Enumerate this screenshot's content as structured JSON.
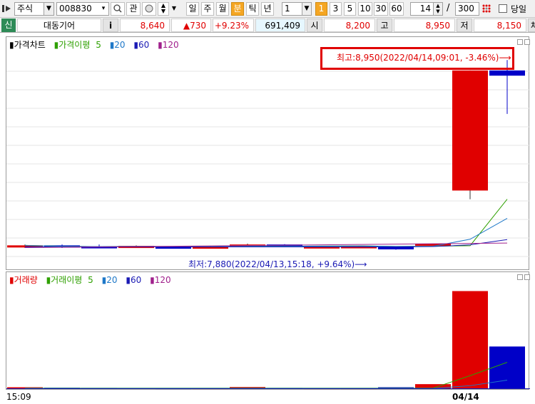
{
  "toolbar": {
    "market": "주식",
    "code": "008830",
    "btn_gwan": "관",
    "periods": [
      "일",
      "주",
      "월",
      "분",
      "틱",
      "년"
    ],
    "active_period": "분",
    "interval_value": "1",
    "interval_presets": [
      "1",
      "3",
      "5",
      "10",
      "30",
      "60"
    ],
    "active_preset": "1",
    "count_value": "14",
    "count_sep": "/",
    "count_total": "300",
    "today_label": "당일"
  },
  "info": {
    "badge": "신",
    "name": "대동기어",
    "info_btn": "i",
    "price": "8,640",
    "change": "▲730",
    "change_pct": "+9.23%",
    "volume": "691,409",
    "open_label": "시",
    "open": "8,200",
    "high_label": "고",
    "high": "8,950",
    "low_label": "저",
    "low": "8,150",
    "trade_label": "체결강"
  },
  "price_panel": {
    "legend_main": "가격차트",
    "legend_ma_label": "가격이평",
    "legend_ma": [
      "5",
      "20",
      "60",
      "120"
    ],
    "high_annotation": "최고:8,950(2022/04/14,09:01, -3.46%)⟶",
    "low_annotation": "최저:7,880(2022/04/13,15:18, +9.64%)⟶"
  },
  "volume_panel": {
    "legend_main": "거래량",
    "legend_ma_label": "거래이평",
    "legend_ma": [
      "5",
      "20",
      "60",
      "120"
    ]
  },
  "x_axis": {
    "left_label": "15:09",
    "date_label": "04/14"
  },
  "colors": {
    "up": "#e00000",
    "down": "#0000c8",
    "ma5": "#2ea000",
    "ma20": "#1e78c8",
    "ma60": "#1a1ab4",
    "ma120": "#a0208c",
    "annotation_box": "#e00000"
  },
  "chart_data": {
    "type": "candlestick",
    "ohlc": [
      {
        "open": 7880,
        "high": 7890,
        "low": 7870,
        "close": 7885
      },
      {
        "open": 7885,
        "high": 7890,
        "low": 7870,
        "close": 7875
      },
      {
        "open": 7880,
        "high": 7890,
        "low": 7870,
        "close": 7875
      },
      {
        "open": 7875,
        "high": 7885,
        "low": 7870,
        "close": 7882
      },
      {
        "open": 7878,
        "high": 7880,
        "low": 7870,
        "close": 7875
      },
      {
        "open": 7875,
        "high": 7880,
        "low": 7870,
        "close": 7878
      },
      {
        "open": 7878,
        "high": 7895,
        "low": 7875,
        "close": 7890
      },
      {
        "open": 7890,
        "high": 7892,
        "low": 7876,
        "close": 7880
      },
      {
        "open": 7878,
        "high": 7882,
        "low": 7874,
        "close": 7879
      },
      {
        "open": 7879,
        "high": 7880,
        "low": 7874,
        "close": 7880
      },
      {
        "open": 7880,
        "high": 7880,
        "low": 7860,
        "close": 7862
      },
      {
        "open": 7890,
        "high": 7895,
        "low": 7890,
        "close": 7895
      },
      {
        "open": 8200,
        "high": 8890,
        "low": 8150,
        "close": 8890
      },
      {
        "open": 8890,
        "high": 8950,
        "low": 8640,
        "close": 8860
      }
    ],
    "volume": [
      8000,
      6000,
      5000,
      4000,
      3000,
      3000,
      9000,
      5000,
      3000,
      3000,
      8000,
      22000,
      440000,
      191000
    ],
    "ma5_price": [
      7885,
      7880,
      7878,
      7879,
      7878,
      7877,
      7880,
      7880,
      7881,
      7882,
      7879,
      7880,
      7883,
      8150,
      8350
    ],
    "x_labels": [
      "15:09",
      "04/14"
    ]
  }
}
